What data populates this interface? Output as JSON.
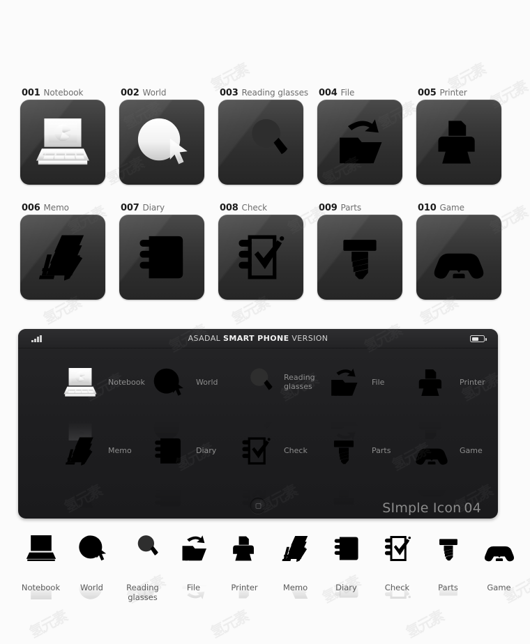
{
  "page": {
    "background_color": "#fbfbfb",
    "watermark_text": "氢元素"
  },
  "tiles": {
    "box_color_top": "#4a4a4a",
    "box_color_bottom": "#262626",
    "items": [
      {
        "number": "001",
        "label": "Notebook",
        "icon": "notebook-icon"
      },
      {
        "number": "002",
        "label": "World",
        "icon": "world-icon"
      },
      {
        "number": "003",
        "label": "Reading glasses",
        "icon": "reading-glasses-icon"
      },
      {
        "number": "004",
        "label": "File",
        "icon": "file-icon"
      },
      {
        "number": "005",
        "label": "Printer",
        "icon": "printer-icon"
      },
      {
        "number": "006",
        "label": "Memo",
        "icon": "memo-icon"
      },
      {
        "number": "007",
        "label": "Diary",
        "icon": "diary-icon"
      },
      {
        "number": "008",
        "label": "Check",
        "icon": "check-icon"
      },
      {
        "number": "009",
        "label": "Parts",
        "icon": "parts-icon"
      },
      {
        "number": "010",
        "label": "Game",
        "icon": "game-icon"
      }
    ]
  },
  "phone": {
    "statusbar": {
      "title_prefix": "ASADAL ",
      "title_bold": "SMART PHONE",
      "title_suffix": " VERSION",
      "signal_icon": "signal-bars-icon",
      "battery_icon": "battery-icon"
    },
    "apps": [
      {
        "label": "Notebook",
        "icon": "notebook-icon"
      },
      {
        "label": "World",
        "icon": "world-icon"
      },
      {
        "label": "Reading\nglasses",
        "icon": "reading-glasses-icon"
      },
      {
        "label": "File",
        "icon": "file-icon"
      },
      {
        "label": "Printer",
        "icon": "printer-icon"
      },
      {
        "label": "Memo",
        "icon": "memo-icon"
      },
      {
        "label": "Diary",
        "icon": "diary-icon"
      },
      {
        "label": "Check",
        "icon": "check-icon"
      },
      {
        "label": "Parts",
        "icon": "parts-icon"
      },
      {
        "label": "Game",
        "icon": "game-icon"
      }
    ],
    "home_button": "home-button",
    "brand_name": "SImple Icon",
    "brand_number": "04"
  },
  "bottom_strip": {
    "icon_color_dark": "#4a5560",
    "icon_color_accent": "#a8c4dd",
    "items": [
      {
        "label": "Notebook",
        "icon": "notebook-icon"
      },
      {
        "label": "World",
        "icon": "world-icon"
      },
      {
        "label": "Reading\nglasses",
        "icon": "reading-glasses-icon"
      },
      {
        "label": "File",
        "icon": "file-icon"
      },
      {
        "label": "Printer",
        "icon": "printer-icon"
      },
      {
        "label": "Memo",
        "icon": "memo-icon"
      },
      {
        "label": "Diary",
        "icon": "diary-icon"
      },
      {
        "label": "Check",
        "icon": "check-icon"
      },
      {
        "label": "Parts",
        "icon": "parts-icon"
      },
      {
        "label": "Game",
        "icon": "game-icon"
      }
    ]
  }
}
